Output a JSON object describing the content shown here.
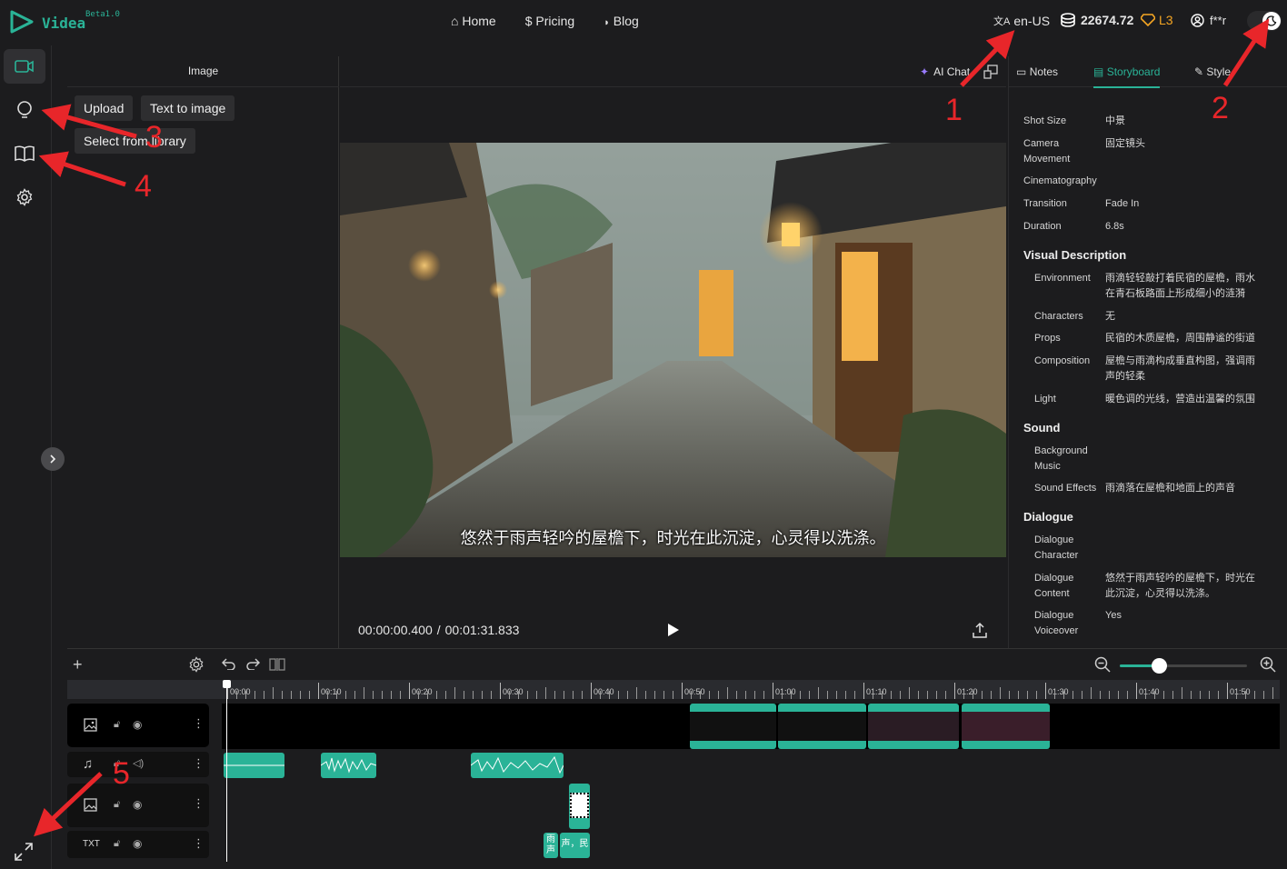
{
  "brand": {
    "name": "Videa",
    "version": "Beta1.0"
  },
  "nav": {
    "home": "Home",
    "pricing": "Pricing",
    "blog": "Blog"
  },
  "header": {
    "language": "en-US",
    "credits": "22674.72",
    "level": "L3",
    "user": "f**r"
  },
  "image_panel": {
    "title": "Image",
    "upload": "Upload",
    "text_to_image": "Text to image",
    "select_from_library": "Select from library"
  },
  "preview": {
    "ai_chat": "AI Chat",
    "subtitle": "悠然于雨声轻吟的屋檐下，时光在此沉淀，心灵得以洗涤。",
    "time_current": "00:00:00.400",
    "time_total": "00:01:31.833"
  },
  "right_tabs": {
    "notes": "Notes",
    "storyboard": "Storyboard",
    "style": "Style"
  },
  "storyboard": {
    "shot_size_label": "Shot Size",
    "shot_size": "中景",
    "camera_label": "Camera Movement",
    "camera": "固定镜头",
    "cinematography_label": "Cinematography",
    "transition_label": "Transition",
    "transition": "Fade In",
    "duration_label": "Duration",
    "duration": "6.8s",
    "visual_title": "Visual Description",
    "environment_label": "Environment",
    "environment": "雨滴轻轻敲打着民宿的屋檐，雨水在青石板路面上形成细小的涟漪",
    "characters_label": "Characters",
    "characters": "无",
    "props_label": "Props",
    "props": "民宿的木质屋檐，周围静谧的街道",
    "composition_label": "Composition",
    "composition": "屋檐与雨滴构成垂直构图，强调雨声的轻柔",
    "light_label": "Light",
    "light": "暖色调的光线，营造出温馨的氛围",
    "sound_title": "Sound",
    "bgm_label": "Background Music",
    "sfx_label": "Sound Effects",
    "sfx": "雨滴落在屋檐和地面上的声音",
    "dialogue_title": "Dialogue",
    "dlg_char_label": "Dialogue Character",
    "dlg_content_label": "Dialogue Content",
    "dlg_content": "悠然于雨声轻吟的屋檐下，时光在此沉淀，心灵得以洗涤。",
    "dlg_vo_label": "Dialogue Voiceover",
    "dlg_vo": "Yes"
  },
  "timeline": {
    "ticks": [
      "00:00",
      "00:10",
      "00:20",
      "00:30",
      "00:40",
      "00:50",
      "01:00",
      "01:10",
      "01:20",
      "01:30",
      "01:40",
      "01:50"
    ],
    "txt_label": "TXT",
    "txt_clips": [
      "雨声",
      "声，民"
    ],
    "zoom_level": 0.31
  },
  "annotations": [
    "1",
    "2",
    "3",
    "4",
    "5"
  ],
  "colors": {
    "accent": "#2ab397",
    "gold": "#f5a623",
    "annotation": "#e8262a"
  }
}
